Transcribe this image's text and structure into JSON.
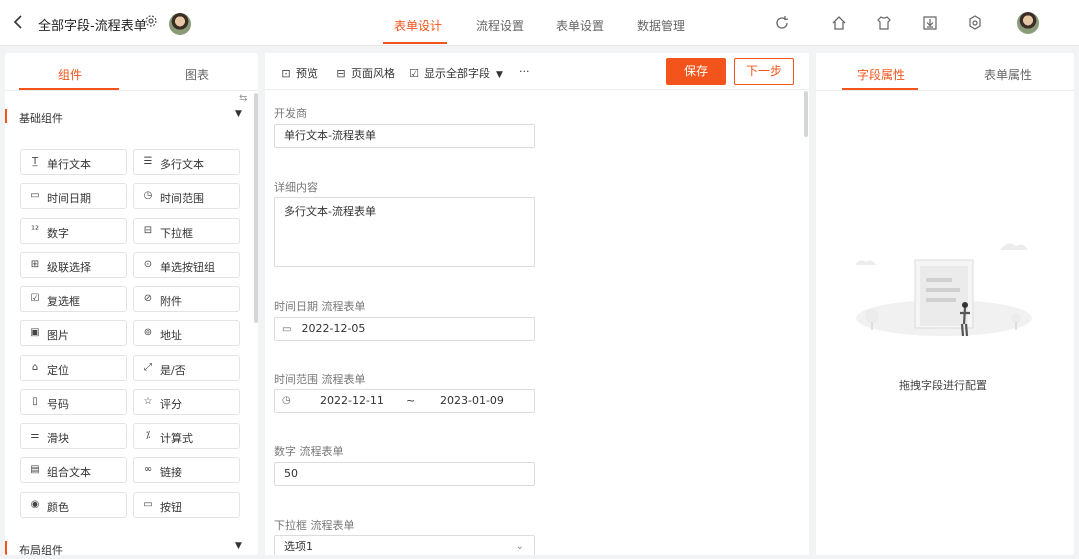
{
  "header": {
    "title": "全部字段-流程表单",
    "back_icon": "chevron-left-icon",
    "tabs": [
      {
        "label": "表单设计",
        "active": true
      },
      {
        "label": "流程设置",
        "active": false
      },
      {
        "label": "表单设置",
        "active": false
      },
      {
        "label": "数据管理",
        "active": false
      }
    ],
    "right_icons": [
      "refresh-icon",
      "home-icon",
      "shirt-icon",
      "download-icon",
      "settings-icon"
    ],
    "accent_color": "#f2541b"
  },
  "left_panel": {
    "tabs": [
      {
        "label": "组件",
        "active": true
      },
      {
        "label": "图表",
        "active": false
      }
    ],
    "section_basic": "基础组件",
    "section_layout": "布局组件",
    "components": [
      {
        "label": "单行文本",
        "icon": "T̲"
      },
      {
        "label": "多行文本",
        "icon": "☰"
      },
      {
        "label": "时间日期",
        "icon": "▭"
      },
      {
        "label": "时间范围",
        "icon": "◷"
      },
      {
        "label": "数字",
        "icon": "¹²"
      },
      {
        "label": "下拉框",
        "icon": "⊟"
      },
      {
        "label": "级联选择",
        "icon": "⊞"
      },
      {
        "label": "单选按钮组",
        "icon": "⊙"
      },
      {
        "label": "复选框",
        "icon": "☑"
      },
      {
        "label": "附件",
        "icon": "⊘"
      },
      {
        "label": "图片",
        "icon": "▣"
      },
      {
        "label": "地址",
        "icon": "⊚"
      },
      {
        "label": "定位",
        "icon": "⌂"
      },
      {
        "label": "是/否",
        "icon": "⤢"
      },
      {
        "label": "号码",
        "icon": "▯"
      },
      {
        "label": "评分",
        "icon": "☆"
      },
      {
        "label": "滑块",
        "icon": "⚌"
      },
      {
        "label": "计算式",
        "icon": "⁒"
      },
      {
        "label": "组合文本",
        "icon": "▤"
      },
      {
        "label": "链接",
        "icon": "∞"
      },
      {
        "label": "颜色",
        "icon": "◉"
      },
      {
        "label": "按钮",
        "icon": "▭"
      }
    ]
  },
  "middle_panel": {
    "toolbar": {
      "preview": "预览",
      "page_style": "页面风格",
      "show_all_fields": "显示全部字段",
      "more": "···",
      "save": "保存",
      "next": "下一步"
    },
    "fields": [
      {
        "label": "开发商",
        "value": "单行文本-流程表单",
        "type": "input"
      },
      {
        "label": "详细内容",
        "value": "多行文本-流程表单",
        "type": "textarea"
      },
      {
        "label": "时间日期 流程表单",
        "value": "2022-12-05",
        "type": "date"
      },
      {
        "label": "时间范围 流程表单",
        "start": "2022-12-11",
        "separator": "~",
        "end": "2023-01-09",
        "type": "range"
      },
      {
        "label": "数字 流程表单",
        "value": "50",
        "type": "input"
      },
      {
        "label": "下拉框 流程表单",
        "value": "选项1",
        "type": "select"
      }
    ]
  },
  "right_panel": {
    "tabs": [
      {
        "label": "字段属性",
        "active": true
      },
      {
        "label": "表单属性",
        "active": false
      }
    ],
    "empty_text": "拖拽字段进行配置"
  }
}
